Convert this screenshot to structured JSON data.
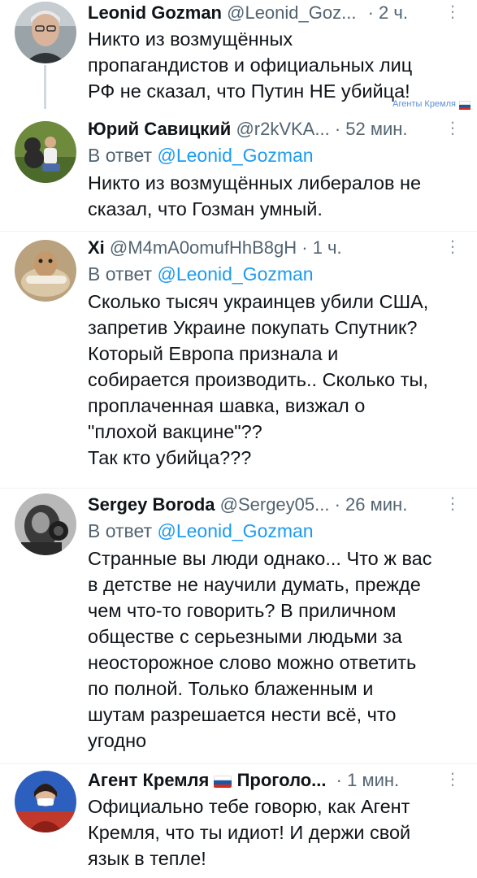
{
  "tweets": [
    {
      "name": "Leonid Gozman",
      "handle": "@Leonid_Goz...",
      "time": "· 2 ч.",
      "body": "Никто из возмущённых\nпропагандистов и официальных лиц\nРФ не сказал, что Путин НЕ убийца!"
    },
    {
      "name": "Юрий Савицкий",
      "handle": "@r2kVKA...",
      "time": "· 52 мин.",
      "reply_prefix": "В ответ",
      "reply_to": "@Leonid_Gozman",
      "body": "Никто из возмущённых либералов не\nсказал, что Гозман умный."
    },
    {
      "name": "Xi",
      "handle": "@M4mA0omufHhB8gH",
      "time": "· 1 ч.",
      "reply_prefix": "В ответ",
      "reply_to": "@Leonid_Gozman",
      "body": "Сколько тысяч украинцев убили США,\nзапретив Украине покупать Спутник?\nКоторый Европа признала и\nсобирается производить.. Сколько ты,\nпроплаченная шавка, визжал о\n\"плохой вакцине\"??\nТак кто убийца???"
    },
    {
      "name": "Sergey Boroda",
      "handle": "@Sergey05...",
      "time": "· 26 мин.",
      "reply_prefix": "В ответ",
      "reply_to": "@Leonid_Gozman",
      "body": "Странные вы люди однако... Что ж вас\nв детстве не научили думать, прежде\nчем что-то говорить? В приличном\nобществе с серьезными людьми за\nнеосторожное слово можно ответить\nпо полной. Только блаженным и\nшутам разрешается нести всё, что\nугодно"
    },
    {
      "name_part1": "Агент Кремля",
      "name_part2": "Проголо...",
      "time": "· 1 мин.",
      "body": "Официально тебе говорю, как Агент\nКремля, что ты идиот! И держи свой\nязык в тепле!"
    }
  ],
  "watermark": "Агенты Кремля",
  "icons": {
    "more": "more-vertical-icon",
    "flag": "russian-flag-icon"
  },
  "colors": {
    "link": "#1d9bf0",
    "secondary": "#536471",
    "text": "#0f1419"
  }
}
